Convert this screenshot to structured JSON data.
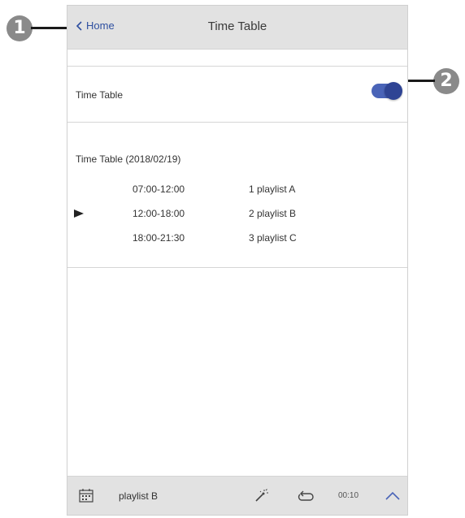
{
  "header": {
    "back_label": "Home",
    "title": "Time Table"
  },
  "settings": {
    "timetable_label": "Time Table",
    "timetable_enabled": true
  },
  "schedule": {
    "title": "Time Table (2018/02/19)",
    "rows": [
      {
        "time": "07:00-12:00",
        "playlist": "1 playlist A",
        "active": false
      },
      {
        "time": "12:00-18:00",
        "playlist": "2 playlist B",
        "active": true
      },
      {
        "time": "18:00-21:30",
        "playlist": "3 playlist C",
        "active": false
      }
    ]
  },
  "footer": {
    "playlist_name": "playlist B",
    "time": "00:10"
  },
  "callouts": [
    "1",
    "2"
  ],
  "colors": {
    "accent": "#4a64b8",
    "link": "#2e4fa0",
    "header_bg": "#e2e2e2",
    "callout": "#8a8a8a"
  }
}
